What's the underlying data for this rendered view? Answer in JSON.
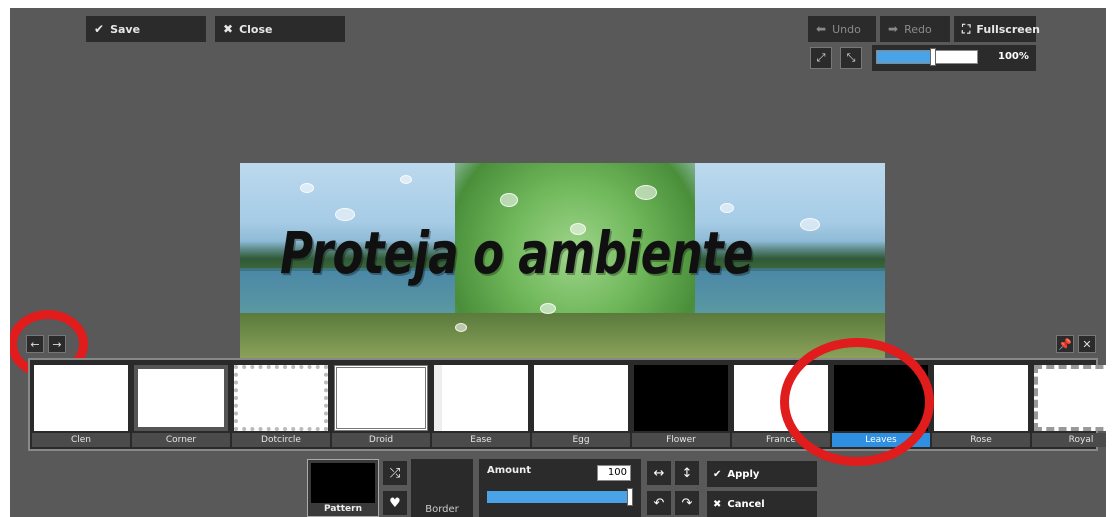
{
  "toolbar": {
    "save_label": "Save",
    "close_label": "Close",
    "undo_label": "Undo",
    "redo_label": "Redo",
    "fullscreen_label": "Fullscreen",
    "zoom_label": "100%",
    "zoom_fraction": 0.56
  },
  "photo": {
    "overlay_text": "Proteja o ambiente"
  },
  "borders": {
    "items": [
      {
        "label": "Clen",
        "style": "plain"
      },
      {
        "label": "Corner",
        "style": "corner"
      },
      {
        "label": "Dotcircle",
        "style": "dotcircle"
      },
      {
        "label": "Droid",
        "style": "droid"
      },
      {
        "label": "Ease",
        "style": "ease"
      },
      {
        "label": "Egg",
        "style": "plain"
      },
      {
        "label": "Flower",
        "style": "black"
      },
      {
        "label": "France",
        "style": "plain"
      },
      {
        "label": "Leaves",
        "style": "black",
        "selected": true
      },
      {
        "label": "Rose",
        "style": "plain"
      },
      {
        "label": "Royal",
        "style": "royal"
      }
    ]
  },
  "controls": {
    "pattern_label": "Pattern",
    "border_label": "Border",
    "amount_label": "Amount",
    "amount_value": "100",
    "amount_fraction": 1.0,
    "apply_label": "Apply",
    "cancel_label": "Cancel"
  },
  "colors": {
    "accent": "#2f8fe0",
    "highlight_ring": "#e01c1c",
    "panel": "#2b2b2b",
    "workspace": "#595959"
  }
}
